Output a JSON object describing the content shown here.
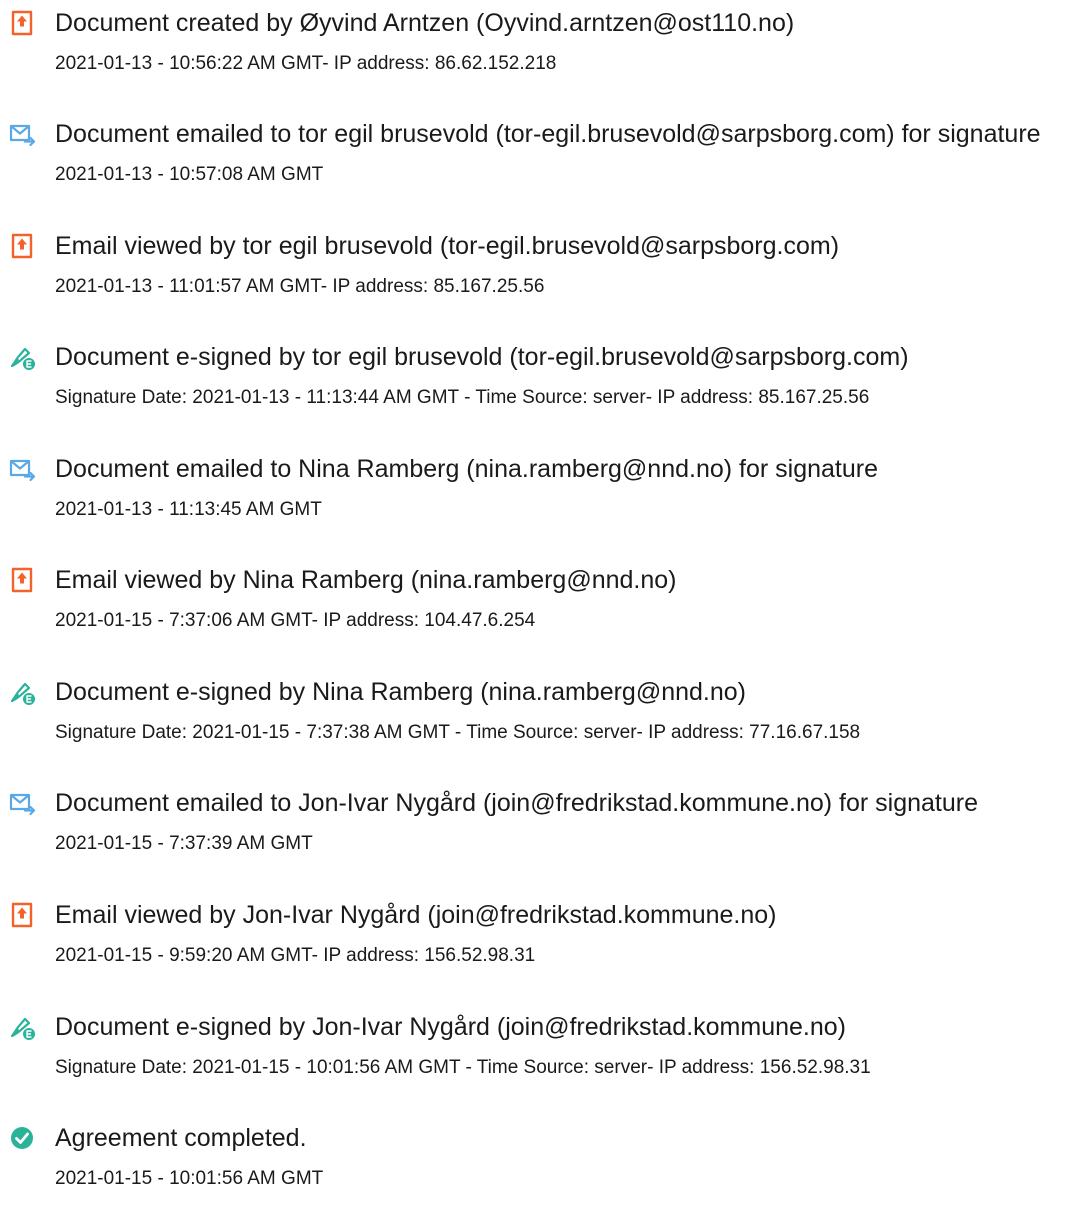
{
  "colors": {
    "created": "#f4622b",
    "emailed": "#5aa9e6",
    "signed": "#2bb39a",
    "completed": "#2bb39a",
    "text": "#1a1a1a"
  },
  "events": [
    {
      "icon": "document-created-icon",
      "title": "Document created by Øyvind Arntzen (Oyvind.arntzen@ost110.no)",
      "detail": "2021-01-13 - 10:56:22 AM GMT- IP address: 86.62.152.218"
    },
    {
      "icon": "email-sent-icon",
      "title": "Document emailed to tor egil brusevold (tor-egil.brusevold@sarpsborg.com) for signature",
      "detail": "2021-01-13 - 10:57:08 AM GMT"
    },
    {
      "icon": "email-viewed-icon",
      "title": "Email viewed by tor egil brusevold (tor-egil.brusevold@sarpsborg.com)",
      "detail": "2021-01-13 - 11:01:57 AM GMT- IP address: 85.167.25.56"
    },
    {
      "icon": "e-signed-icon",
      "title": "Document e-signed by tor egil brusevold (tor-egil.brusevold@sarpsborg.com)",
      "detail": "Signature Date: 2021-01-13 - 11:13:44 AM GMT - Time Source: server- IP address: 85.167.25.56"
    },
    {
      "icon": "email-sent-icon",
      "title": "Document emailed to Nina Ramberg (nina.ramberg@nnd.no) for signature",
      "detail": "2021-01-13 - 11:13:45 AM GMT"
    },
    {
      "icon": "email-viewed-icon",
      "title": "Email viewed by Nina Ramberg (nina.ramberg@nnd.no)",
      "detail": "2021-01-15 - 7:37:06 AM GMT- IP address: 104.47.6.254"
    },
    {
      "icon": "e-signed-icon",
      "title": "Document e-signed by Nina Ramberg (nina.ramberg@nnd.no)",
      "detail": "Signature Date: 2021-01-15 - 7:37:38 AM GMT - Time Source: server- IP address: 77.16.67.158"
    },
    {
      "icon": "email-sent-icon",
      "title": "Document emailed to Jon-Ivar Nygård (join@fredrikstad.kommune.no) for signature",
      "detail": "2021-01-15 - 7:37:39 AM GMT"
    },
    {
      "icon": "email-viewed-icon",
      "title": "Email viewed by Jon-Ivar Nygård (join@fredrikstad.kommune.no)",
      "detail": "2021-01-15 - 9:59:20 AM GMT- IP address: 156.52.98.31"
    },
    {
      "icon": "e-signed-icon",
      "title": "Document e-signed by Jon-Ivar Nygård (join@fredrikstad.kommune.no)",
      "detail": "Signature Date: 2021-01-15 - 10:01:56 AM GMT - Time Source: server- IP address: 156.52.98.31"
    },
    {
      "icon": "agreement-completed-icon",
      "title": "Agreement completed.",
      "detail": "2021-01-15 - 10:01:56 AM GMT"
    }
  ]
}
